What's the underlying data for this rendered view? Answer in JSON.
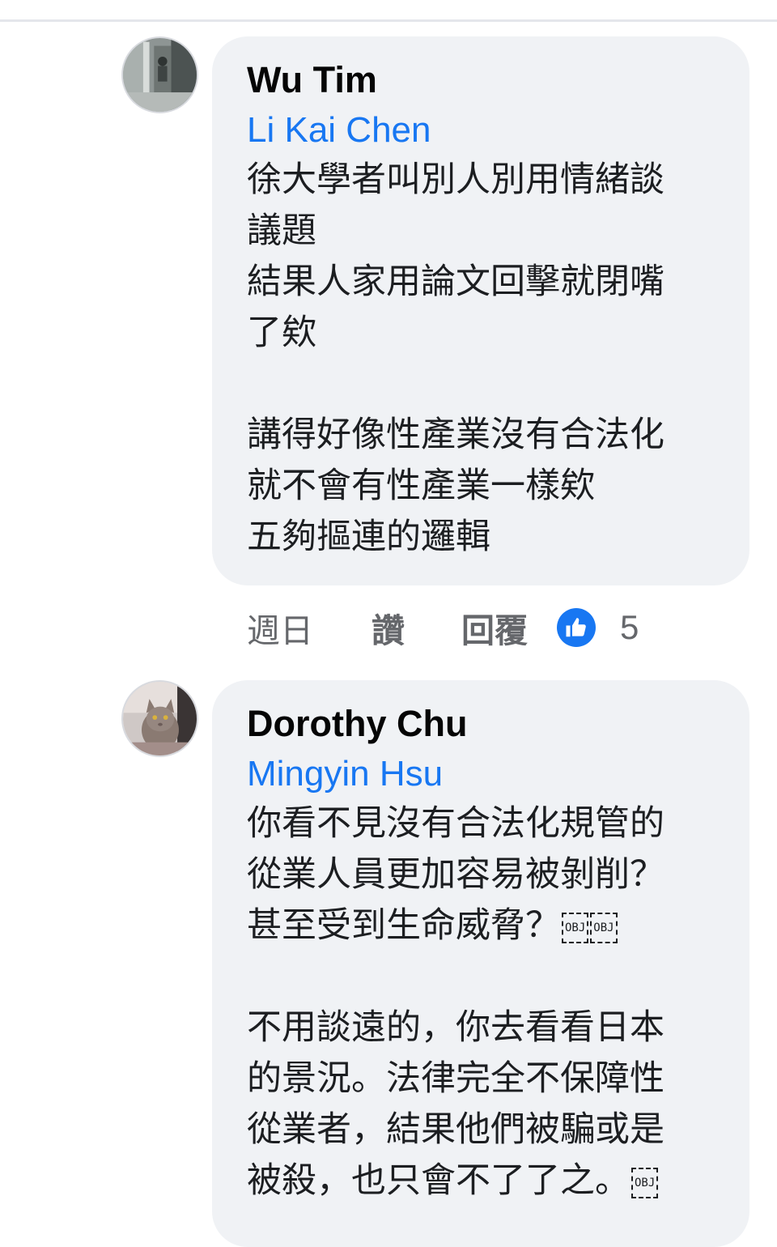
{
  "comments": [
    {
      "author": "Wu Tim",
      "mention": "Li Kai Chen",
      "lines": [
        "徐大學者叫別人別用情緒談",
        "議題",
        "結果人家用論文回擊就閉嘴",
        "了欸",
        "",
        "講得好像性產業沒有合法化",
        "就不會有性產業一樣欸",
        "五夠摳連的邏輯"
      ],
      "time": "週日",
      "like_label": "讚",
      "reply_label": "回覆",
      "reaction_icon": "thumbs-up-icon",
      "reaction_count": "5"
    },
    {
      "author": "Dorothy Chu",
      "mention": "Mingyin Hsu",
      "lines": [
        "你看不見沒有合法化規管的",
        "從業人員更加容易被剝削？",
        "甚至受到生命威脅？",
        "",
        "不用談遠的，你去看看日本",
        "的景況。法律完全不保障性",
        "從業者，結果他們被騙或是",
        "被殺，也只會不了了之。"
      ],
      "obj_placeholder": "OBJ"
    }
  ],
  "colors": {
    "bubble_bg": "#f0f2f5",
    "mention": "#1877f2",
    "reaction_blue": "#1877f2",
    "meta_text": "#65676b"
  }
}
